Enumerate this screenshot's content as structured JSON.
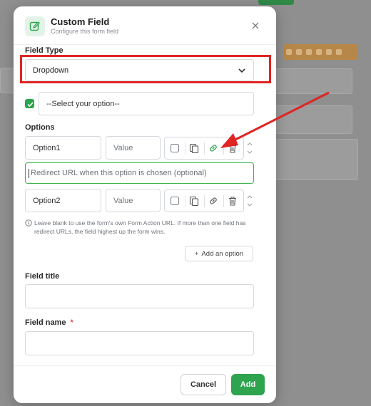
{
  "dialog": {
    "title": "Custom Field",
    "subtitle": "Configure this form field",
    "header_icon": "edit-icon",
    "close_icon": "close-icon"
  },
  "field_type": {
    "label": "Field Type",
    "value": "Dropdown"
  },
  "default_option": {
    "checked": true,
    "value": "--Select your option--"
  },
  "options": {
    "label": "Options",
    "rows": [
      {
        "name": "Option1",
        "value_placeholder": "Value",
        "checked": false,
        "link_active": true
      },
      {
        "name": "Option2",
        "value_placeholder": "Value",
        "checked": false,
        "link_active": false
      }
    ],
    "redirect_placeholder": "Redirect URL when this option is chosen (optional)",
    "note": "Leave blank to use the form's own Form Action URL. If more than one field has redirect URLs, the field highest up the form wins.",
    "add_option_label": "Add an option"
  },
  "field_title": {
    "label": "Field title",
    "value": ""
  },
  "field_name": {
    "label": "Field name",
    "required_mark": "*",
    "value": ""
  },
  "footer": {
    "cancel_label": "Cancel",
    "add_label": "Add"
  },
  "colors": {
    "accent_green": "#2ea44f",
    "annotation_red": "#e02424"
  }
}
